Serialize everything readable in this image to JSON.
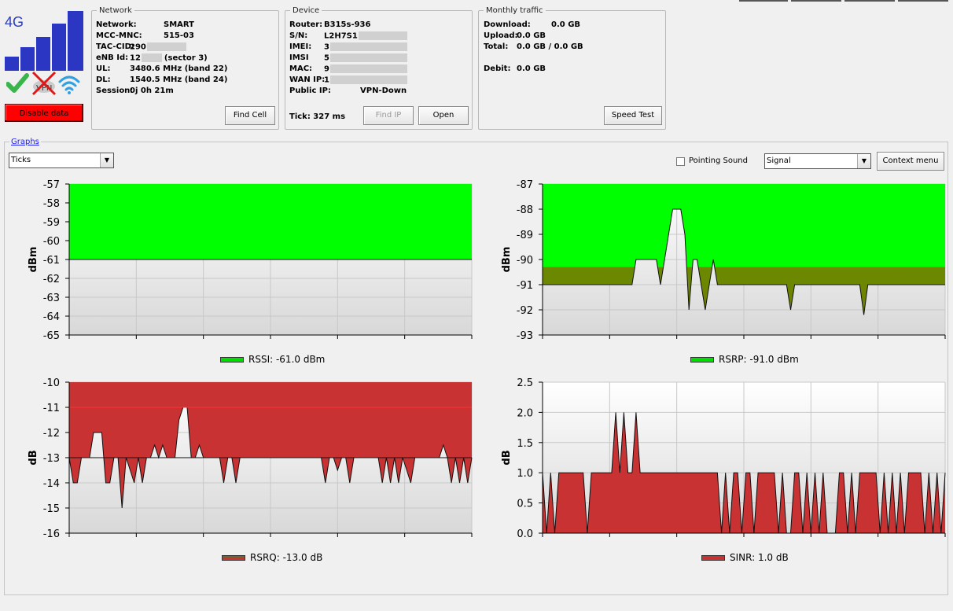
{
  "status": {
    "network_type": "4G",
    "signal_bars": 5,
    "vpn_label": "VPN",
    "disable_data_label": "Disable data",
    "colors": {
      "bars": "#2b36c2",
      "ok": "#39b54a",
      "vpn_x": "#e01818",
      "wifi": "#32a0e0",
      "disable": "#ff0000"
    },
    "icons": [
      "check-icon",
      "vpn-crossed-icon",
      "wifi-icon"
    ]
  },
  "network": {
    "legend": "Network",
    "rows": [
      {
        "label": "Network:",
        "value": "SMART"
      },
      {
        "label": "MCC-MNC:",
        "value": "515-03"
      },
      {
        "label": "TAC-CID:",
        "value": "290"
      },
      {
        "label": "eNB Id:",
        "value": "12",
        "suffix": "(sector 3)"
      },
      {
        "label": "UL:",
        "value": "3480.6 MHz (band 22)"
      },
      {
        "label": "DL:",
        "value": "1540.5 MHz (band 24)"
      },
      {
        "label": "Session:",
        "value": "0j 0h 21m"
      }
    ],
    "find_cell_label": "Find Cell"
  },
  "device": {
    "legend": "Device",
    "rows": [
      {
        "label": "Router:",
        "value": "B315s-936"
      },
      {
        "label": "S/N:",
        "value": "L2H7S1"
      },
      {
        "label": "IMEI:",
        "value": "3"
      },
      {
        "label": "IMSI",
        "value": "5"
      },
      {
        "label": "MAC:",
        "value": "9"
      },
      {
        "label": "WAN IP:",
        "value": "1"
      },
      {
        "label": "Public IP:",
        "value": "VPN-Down"
      }
    ],
    "tick": "Tick: 327 ms",
    "find_ip_label": "Find IP",
    "open_label": "Open"
  },
  "traffic": {
    "legend": "Monthly traffic",
    "rows": [
      {
        "label": "Download:",
        "value": "0.0 GB"
      },
      {
        "label": "Upload:",
        "value": "0.0 GB"
      },
      {
        "label": "Total:",
        "value": "0.0 GB / 0.0 GB"
      },
      {
        "label": "Debit:",
        "value": "0.0 GB"
      }
    ],
    "speed_test_label": "Speed Test"
  },
  "graphs": {
    "legend": "Graphs",
    "mode_select": "Ticks",
    "pointing_sound_label": "Pointing Sound",
    "pointing_sound_checked": false,
    "view_select": "Signal",
    "context_menu_label": "Context menu"
  },
  "chart_data": [
    {
      "type": "area",
      "ylabel": "dBm",
      "ylim": [
        -65,
        -57
      ],
      "yticks": [
        "-57",
        "-58",
        "-59",
        "-60",
        "-61",
        "-62",
        "-63",
        "-64",
        "-65"
      ],
      "grid": true,
      "fill_color": "#00ff00",
      "baseline": "top",
      "series": [
        {
          "name": "RSSI: -61.0 dBm",
          "values": [
            -61,
            -61,
            -61,
            -61,
            -61,
            -61,
            -61,
            -61,
            -61,
            -61
          ]
        }
      ],
      "legend_color": "#00dd00"
    },
    {
      "type": "area",
      "ylabel": "dBm",
      "ylim": [
        -93,
        -87
      ],
      "yticks": [
        "-87",
        "-88",
        "-89",
        "-90",
        "-91",
        "-92",
        "-93"
      ],
      "grid": true,
      "fill_color": "#00ff00",
      "baseline": "top",
      "series": [
        {
          "name": "RSRP: -91.0 dBm",
          "values": [
            -91,
            -91,
            -91,
            -91,
            -91,
            -91,
            -91,
            -91,
            -91,
            -91,
            -91,
            -91,
            -91,
            -91,
            -91,
            -91,
            -91,
            -91,
            -91,
            -91,
            -91,
            -91,
            -91,
            -90,
            -90,
            -90,
            -90,
            -90,
            -90,
            -91,
            -90,
            -89,
            -88,
            -88,
            -88,
            -89,
            -92,
            -90,
            -90,
            -91,
            -92,
            -91,
            -90,
            -91,
            -91,
            -91,
            -91,
            -91,
            -91,
            -91,
            -91,
            -91,
            -91,
            -91,
            -91,
            -91,
            -91,
            -91,
            -91,
            -91,
            -91,
            -92,
            -91,
            -91,
            -91,
            -91,
            -91,
            -91,
            -91,
            -91,
            -91,
            -91,
            -91,
            -91,
            -91,
            -91,
            -91,
            -91,
            -91,
            -92.2,
            -91,
            -91,
            -91,
            -91,
            -91,
            -91,
            -91,
            -91,
            -91,
            -91,
            -91,
            -91,
            -91,
            -91,
            -91,
            -91,
            -91,
            -91,
            -91,
            -91
          ]
        }
      ],
      "legend_color": "#00dd00"
    },
    {
      "type": "area",
      "ylabel": "dB",
      "ylim": [
        -16,
        -10
      ],
      "yticks": [
        "-10",
        "-11",
        "-12",
        "-13",
        "-14",
        "-15",
        "-16"
      ],
      "grid": true,
      "fill_color": "#c83232",
      "baseline": "top",
      "threshold": -11,
      "series": [
        {
          "name": "RSRQ: -13.0 dB",
          "values": [
            -13,
            -14,
            -14,
            -13,
            -13,
            -13,
            -12,
            -12,
            -12,
            -14,
            -14,
            -13,
            -13,
            -15,
            -13,
            -13.5,
            -14,
            -13,
            -14,
            -13,
            -13,
            -12.5,
            -13,
            -12.5,
            -13,
            -13,
            -13,
            -11.5,
            -11,
            -11,
            -13,
            -13,
            -12.5,
            -13,
            -13,
            -13,
            -13,
            -13,
            -14,
            -13,
            -13,
            -14,
            -13,
            -13,
            -13,
            -13,
            -13,
            -13,
            -13,
            -13,
            -13,
            -13,
            -13,
            -13,
            -13,
            -13,
            -13,
            -13,
            -13,
            -13,
            -13,
            -13,
            -13,
            -14,
            -13,
            -13,
            -13.5,
            -13,
            -13,
            -14,
            -13,
            -13,
            -13,
            -13,
            -13,
            -13,
            -13,
            -14,
            -13,
            -14,
            -13,
            -14,
            -13,
            -13.5,
            -14,
            -13,
            -13,
            -13,
            -13,
            -13,
            -13,
            -13,
            -12.5,
            -13,
            -14,
            -13,
            -14,
            -13,
            -14,
            -13
          ]
        }
      ],
      "legend_color": "#c83232"
    },
    {
      "type": "area",
      "ylabel": "dB",
      "ylim": [
        0,
        2.5
      ],
      "yticks": [
        "2.5",
        "2.0",
        "1.5",
        "1.0",
        "0.5",
        "0.0"
      ],
      "grid": true,
      "fill_color": "#c83232",
      "baseline": "bottom",
      "series": [
        {
          "name": "SINR: 1.0 dB",
          "values": [
            1,
            0,
            1,
            0,
            1,
            1,
            1,
            1,
            1,
            1,
            1,
            0,
            1,
            1,
            1,
            1,
            1,
            1,
            2,
            1,
            2,
            1,
            1,
            2,
            1,
            1,
            1,
            1,
            1,
            1,
            1,
            1,
            1,
            1,
            1,
            1,
            1,
            1,
            1,
            1,
            1,
            1,
            1,
            1,
            0,
            1,
            0,
            1,
            1,
            0,
            1,
            1,
            0,
            1,
            1,
            1,
            1,
            1,
            0,
            1,
            0,
            0,
            1,
            1,
            0,
            1,
            0,
            1,
            0,
            1,
            0,
            0,
            0,
            1,
            1,
            0,
            1,
            0,
            1,
            1,
            1,
            1,
            1,
            0,
            1,
            0,
            1,
            0,
            1,
            0,
            1,
            1,
            1,
            1,
            0,
            1,
            0,
            1,
            0,
            1
          ]
        }
      ],
      "legend_color": "#c83232"
    }
  ]
}
